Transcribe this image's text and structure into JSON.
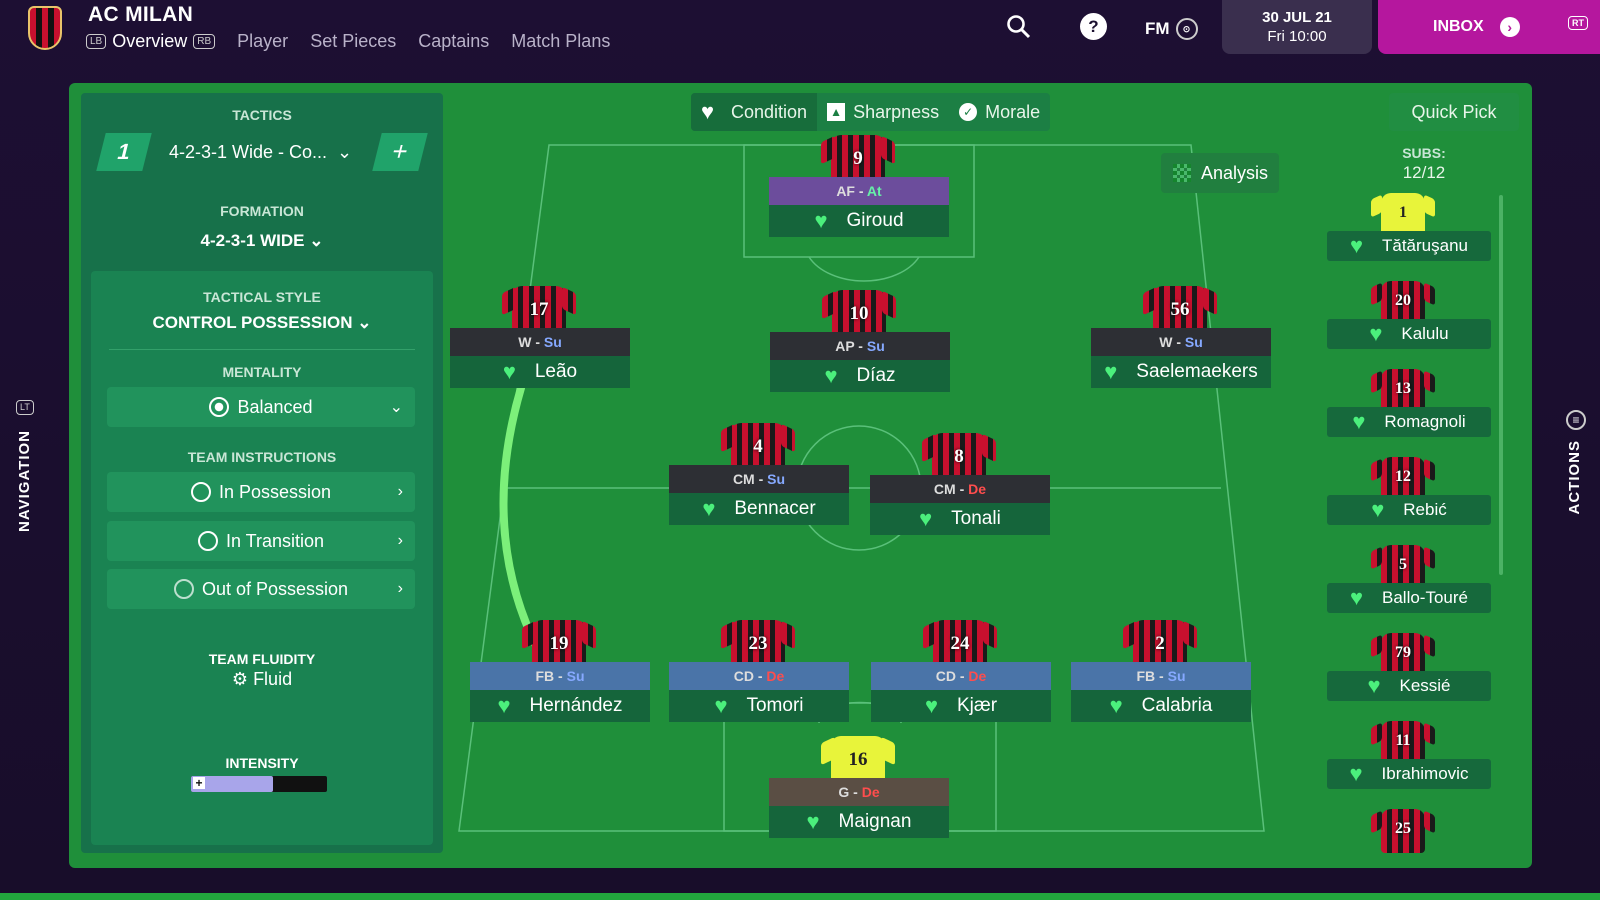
{
  "header": {
    "club": "AC MILAN",
    "tabs": [
      {
        "label": "Overview",
        "active": true
      },
      {
        "label": "Player",
        "active": false
      },
      {
        "label": "Set Pieces",
        "active": false
      },
      {
        "label": "Captains",
        "active": false
      },
      {
        "label": "Match Plans",
        "active": false
      }
    ],
    "lb_hint": "LB",
    "rb_hint": "RB",
    "fm_label": "FM",
    "date": "30 JUL 21",
    "time": "Fri 10:00",
    "inbox_label": "INBOX",
    "rt_hint": "RT"
  },
  "navigation_label": "NAVIGATION",
  "lt_hint": "LT",
  "actions_label": "ACTIONS",
  "tactics": {
    "title": "TACTICS",
    "slot": "1",
    "name": "4-2-3-1 Wide - Co...",
    "formation_title": "FORMATION",
    "formation": "4-2-3-1 WIDE",
    "style_title": "TACTICAL STYLE",
    "style": "CONTROL POSSESSION",
    "mentality_title": "MENTALITY",
    "mentality": "Balanced",
    "instructions_title": "TEAM INSTRUCTIONS",
    "instructions": [
      "In Possession",
      "In Transition",
      "Out of Possession"
    ],
    "fluidity_title": "TEAM FLUIDITY",
    "fluidity": "Fluid",
    "intensity_title": "INTENSITY",
    "intensity_level": 0.6
  },
  "toggles": [
    "Condition",
    "Sharpness",
    "Morale"
  ],
  "quick_pick": "Quick Pick",
  "analysis": "Analysis",
  "subs": {
    "label": "SUBS:",
    "count": "12/12"
  },
  "lineup": [
    {
      "number": "9",
      "pos": "AF",
      "duty": "At",
      "name": "Giroud"
    },
    {
      "number": "17",
      "pos": "W",
      "duty": "Su",
      "name": "Leão"
    },
    {
      "number": "10",
      "pos": "AP",
      "duty": "Su",
      "name": "Díaz"
    },
    {
      "number": "56",
      "pos": "W",
      "duty": "Su",
      "name": "Saelemaekers"
    },
    {
      "number": "4",
      "pos": "CM",
      "duty": "Su",
      "name": "Bennacer"
    },
    {
      "number": "8",
      "pos": "CM",
      "duty": "De",
      "name": "Tonali"
    },
    {
      "number": "19",
      "pos": "FB",
      "duty": "Su",
      "name": "Hernández"
    },
    {
      "number": "23",
      "pos": "CD",
      "duty": "De",
      "name": "Tomori"
    },
    {
      "number": "24",
      "pos": "CD",
      "duty": "De",
      "name": "Kjær"
    },
    {
      "number": "2",
      "pos": "FB",
      "duty": "Su",
      "name": "Calabria"
    },
    {
      "number": "16",
      "pos": "G",
      "duty": "De",
      "name": "Maignan"
    }
  ],
  "substitutes": [
    {
      "number": "1",
      "name": "Tătăruşanu",
      "gk": true
    },
    {
      "number": "20",
      "name": "Kalulu"
    },
    {
      "number": "13",
      "name": "Romagnoli"
    },
    {
      "number": "12",
      "name": "Rebić"
    },
    {
      "number": "5",
      "name": "Ballo-Touré"
    },
    {
      "number": "79",
      "name": "Kessié"
    },
    {
      "number": "11",
      "name": "Ibrahimovic"
    },
    {
      "number": "25",
      "name": ""
    }
  ],
  "colors": {
    "pitch": "#1f8f3a",
    "panel": "#17714a",
    "inbox": "#b5179e",
    "condition_heart": "#4bf07c",
    "attack_duty": "#66f0a8",
    "support_duty": "#86a9ff",
    "defend_duty": "#ff4d4d"
  }
}
